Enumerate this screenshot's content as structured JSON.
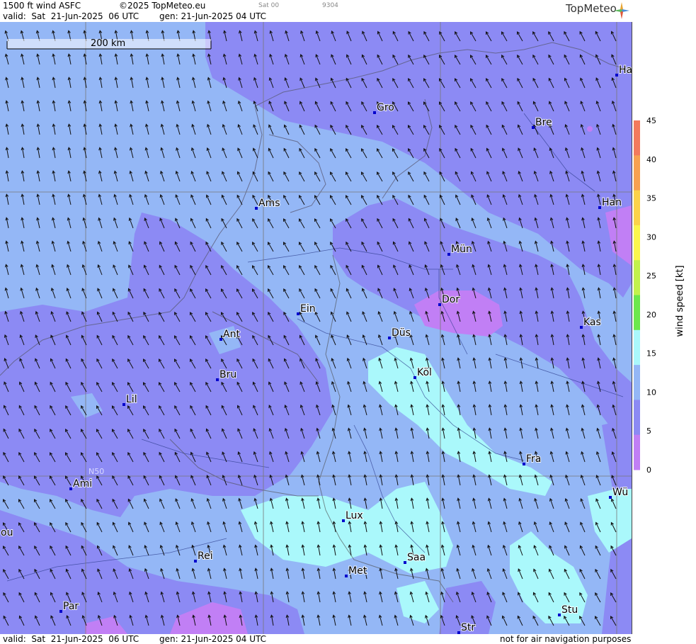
{
  "header": {
    "product": "1500 ft wind ASFC",
    "copyright": "©2025 TopMeteo.eu",
    "day_code": "Sat 00",
    "code": "9304",
    "valid": "valid:  Sat  21-Jun-2025  06 UTC",
    "generated": "gen: 21-Jun-2025 04 UTC",
    "logo_text": "TopMeteo"
  },
  "footer": {
    "valid": "valid:  Sat  21-Jun-2025  06 UTC",
    "generated": "gen: 21-Jun-2025 04 UTC",
    "disclaimer": "not for air navigation purposes"
  },
  "map": {
    "scale_label": "200 km",
    "lat_label": "N50",
    "colors": {
      "cyan": "#aaf8fb",
      "blue": "#94b7f6",
      "periwinkle": "#8c8af4",
      "purple": "#c17ff5",
      "lavender": "#a57ff5"
    },
    "cities": [
      {
        "name": "Gro"
      },
      {
        "name": "Bre"
      },
      {
        "name": "Ha"
      },
      {
        "name": "Ams"
      },
      {
        "name": "Han"
      },
      {
        "name": "Mün"
      },
      {
        "name": "Ein"
      },
      {
        "name": "Dor"
      },
      {
        "name": "Ant"
      },
      {
        "name": "Düs"
      },
      {
        "name": "Kas"
      },
      {
        "name": "Bru"
      },
      {
        "name": "Köl"
      },
      {
        "name": "Lil"
      },
      {
        "name": "Fra"
      },
      {
        "name": "Ami"
      },
      {
        "name": "Wü"
      },
      {
        "name": "Lux"
      },
      {
        "name": "Rei"
      },
      {
        "name": "Saa"
      },
      {
        "name": "Met"
      },
      {
        "name": "ou"
      },
      {
        "name": "Par"
      },
      {
        "name": "Stu"
      },
      {
        "name": "Str"
      }
    ]
  },
  "legend": {
    "title": "wind speed [kt]",
    "ticks": [
      "45",
      "40",
      "35",
      "30",
      "25",
      "20",
      "15",
      "10",
      "5",
      "0"
    ],
    "colors": [
      "#f27a5c",
      "#f6a150",
      "#fcd24a",
      "#fbf64c",
      "#c2f24c",
      "#6ce84c",
      "#aaf8fb",
      "#94b7f6",
      "#8c8af4",
      "#c17ff5"
    ]
  }
}
